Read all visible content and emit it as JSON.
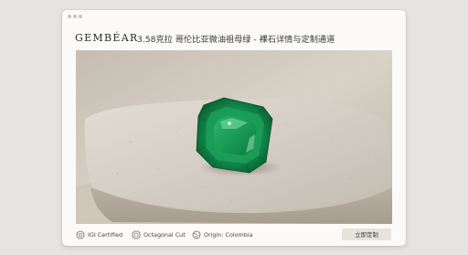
{
  "header": {
    "brand": "GEMBÉAR",
    "title": "3.58克拉 哥伦比亚微油祖母绿 - 裸石详情与定制通道"
  },
  "hero": {
    "subject": "emerald-cut green emerald resting on a pale stone slab",
    "colors": {
      "emerald": "#138a4b",
      "stone": "#d2cbc2",
      "background": "#b9b1a4"
    }
  },
  "footer": {
    "features": [
      {
        "icon": "certificate-icon",
        "label": "IGI Certified"
      },
      {
        "icon": "octagon-cut-icon",
        "label": "Octagonal Cut"
      },
      {
        "icon": "globe-icon",
        "label": "Origin: Colombia"
      }
    ],
    "cta_label": "立即定制"
  }
}
